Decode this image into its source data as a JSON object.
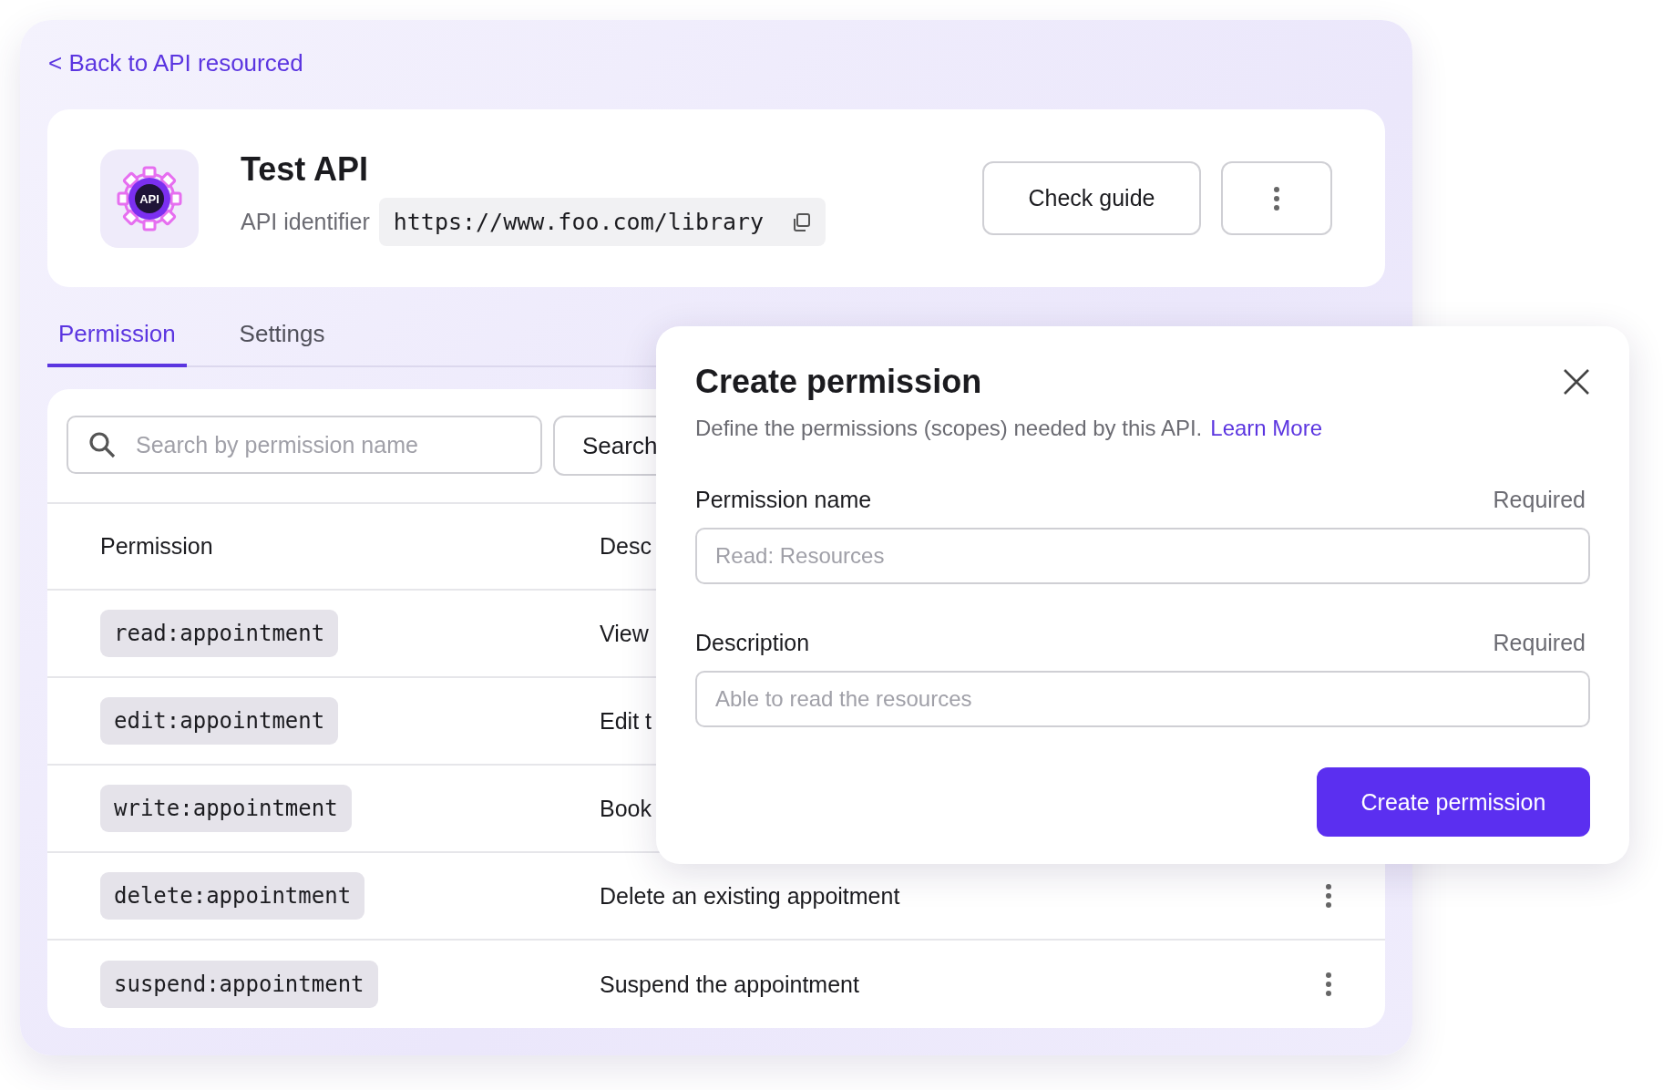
{
  "back_link": "< Back to API resourced",
  "api": {
    "logo_text": "API",
    "name": "Test API",
    "identifier_label": "API identifier",
    "identifier": "https://www.foo.com/library"
  },
  "header_buttons": {
    "check_guide": "Check guide"
  },
  "tabs": [
    {
      "label": "Permission",
      "selected": true
    },
    {
      "label": "Settings",
      "selected": false
    }
  ],
  "search": {
    "placeholder": "Search by permission name",
    "button": "Search"
  },
  "table": {
    "columns": [
      "Permission",
      "Desc"
    ],
    "rows": [
      {
        "permission": "read:appointment",
        "description": "View",
        "more_button": false
      },
      {
        "permission": "edit:appointment",
        "description": "Edit t",
        "more_button": false
      },
      {
        "permission": "write:appointment",
        "description": "Book",
        "more_button": false
      },
      {
        "permission": "delete:appointment",
        "description": "Delete an existing appoitment",
        "more_button": true
      },
      {
        "permission": "suspend:appointment",
        "description": "Suspend the appointment",
        "more_button": true
      }
    ]
  },
  "dialog": {
    "title": "Create permission",
    "subtitle": "Define the permissions (scopes) needed by this API.",
    "link": "Learn More",
    "fields": [
      {
        "label": "Permission name",
        "required": "Required",
        "placeholder": "Read: Resources"
      },
      {
        "label": "Description",
        "required": "Required",
        "placeholder": "Able to read the resources"
      }
    ],
    "submit": "Create permission"
  }
}
